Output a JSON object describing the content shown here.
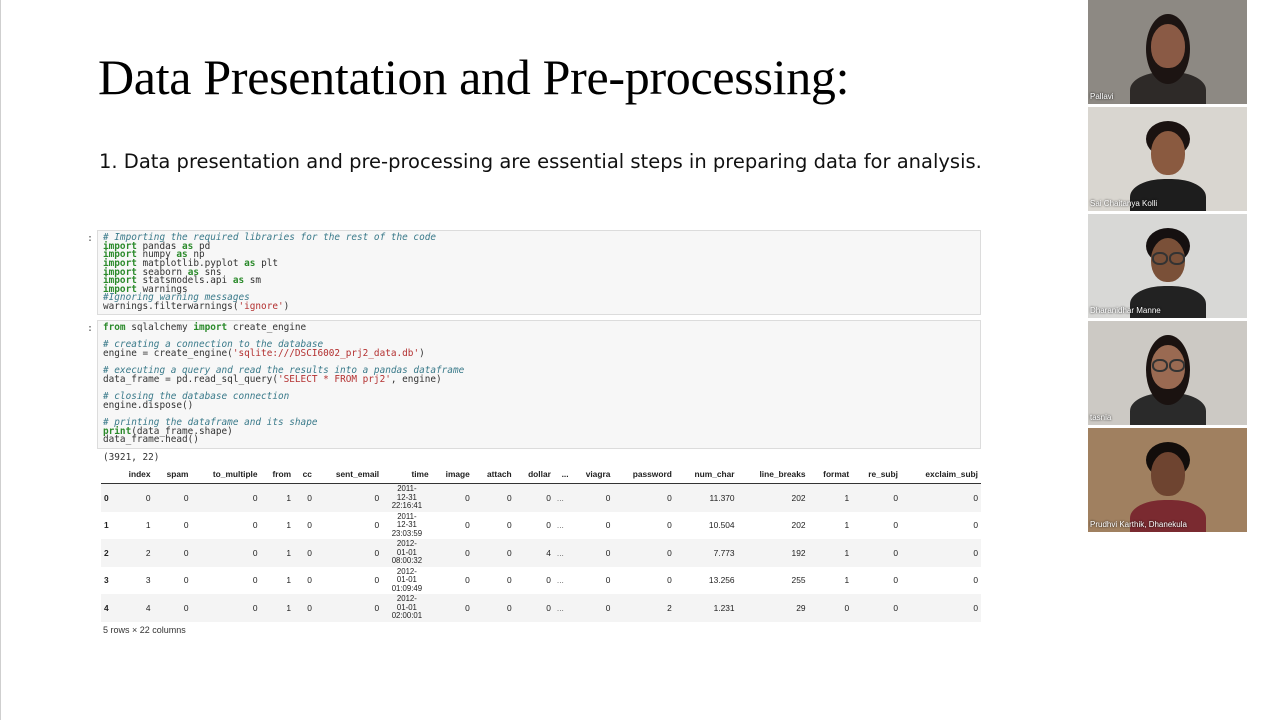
{
  "slide": {
    "title": "Data Presentation and Pre-processing:",
    "bullet": "1. Data presentation and pre-processing are essential steps in preparing data for analysis."
  },
  "notebook": {
    "cell1": {
      "prompt": ":",
      "lines": [
        [
          {
            "t": "# Importing the required libraries for the rest of the code",
            "c": "cmt"
          }
        ],
        [
          {
            "t": "import",
            "c": "kw"
          },
          {
            "t": " pandas "
          },
          {
            "t": "as",
            "c": "kw"
          },
          {
            "t": " pd"
          }
        ],
        [
          {
            "t": "import",
            "c": "kw"
          },
          {
            "t": " numpy "
          },
          {
            "t": "as",
            "c": "kw"
          },
          {
            "t": " np"
          }
        ],
        [
          {
            "t": "import",
            "c": "kw"
          },
          {
            "t": " matplotlib.pyplot "
          },
          {
            "t": "as",
            "c": "kw"
          },
          {
            "t": " plt"
          }
        ],
        [
          {
            "t": "import",
            "c": "kw"
          },
          {
            "t": " seaborn "
          },
          {
            "t": "as",
            "c": "kw"
          },
          {
            "t": " sns"
          }
        ],
        [
          {
            "t": "import",
            "c": "kw"
          },
          {
            "t": " statsmodels.api "
          },
          {
            "t": "as",
            "c": "kw"
          },
          {
            "t": " sm"
          }
        ],
        [
          {
            "t": "import",
            "c": "kw"
          },
          {
            "t": " warnings"
          }
        ],
        [
          {
            "t": "#Ignoring warning messages",
            "c": "cmt"
          }
        ],
        [
          {
            "t": "warnings.filterwarnings("
          },
          {
            "t": "'ignore'",
            "c": "str"
          },
          {
            "t": ")"
          }
        ]
      ]
    },
    "cell2": {
      "prompt": ":",
      "lines": [
        [
          {
            "t": "from",
            "c": "kw"
          },
          {
            "t": " sqlalchemy "
          },
          {
            "t": "import",
            "c": "kw"
          },
          {
            "t": " create_engine"
          }
        ],
        [],
        [
          {
            "t": "# creating a connection to the database",
            "c": "cmt"
          }
        ],
        [
          {
            "t": "engine = create_engine("
          },
          {
            "t": "'sqlite:///DSCI6002_prj2_data.db'",
            "c": "str"
          },
          {
            "t": ")"
          }
        ],
        [],
        [
          {
            "t": "# executing a query and read the results into a pandas dataframe",
            "c": "cmt"
          }
        ],
        [
          {
            "t": "data_frame = pd.read_sql_query("
          },
          {
            "t": "'SELECT * FROM prj2'",
            "c": "str"
          },
          {
            "t": ", engine)"
          }
        ],
        [],
        [
          {
            "t": "# closing the database connection",
            "c": "cmt"
          }
        ],
        [
          {
            "t": "engine.dispose()"
          }
        ],
        [],
        [
          {
            "t": "# printing the dataframe and its shape",
            "c": "cmt"
          }
        ],
        [
          {
            "t": "print",
            "c": "kw"
          },
          {
            "t": "(data_frame.shape)"
          }
        ],
        [
          {
            "t": "data_frame.head()"
          }
        ]
      ]
    },
    "shape_output": "(3921, 22)",
    "dataframe": {
      "columns": [
        "",
        "index",
        "spam",
        "to_multiple",
        "from",
        "cc",
        "sent_email",
        "time",
        "image",
        "attach",
        "dollar",
        "...",
        "viagra",
        "password",
        "num_char",
        "line_breaks",
        "format",
        "re_subj",
        "exclaim_subj"
      ],
      "rows": [
        [
          "0",
          "0",
          "0",
          "0",
          "1",
          "0",
          "0",
          [
            "2011-",
            "12-31",
            "22:16:41"
          ],
          "0",
          "0",
          "0",
          "...",
          "0",
          "0",
          "11.370",
          "202",
          "1",
          "0",
          "0"
        ],
        [
          "1",
          "1",
          "0",
          "0",
          "1",
          "0",
          "0",
          [
            "2011-",
            "12-31",
            "23:03:59"
          ],
          "0",
          "0",
          "0",
          "...",
          "0",
          "0",
          "10.504",
          "202",
          "1",
          "0",
          "0"
        ],
        [
          "2",
          "2",
          "0",
          "0",
          "1",
          "0",
          "0",
          [
            "2012-",
            "01-01",
            "08:00:32"
          ],
          "0",
          "0",
          "4",
          "...",
          "0",
          "0",
          "7.773",
          "192",
          "1",
          "0",
          "0"
        ],
        [
          "3",
          "3",
          "0",
          "0",
          "1",
          "0",
          "0",
          [
            "2012-",
            "01-01",
            "01:09:49"
          ],
          "0",
          "0",
          "0",
          "...",
          "0",
          "0",
          "13.256",
          "255",
          "1",
          "0",
          "0"
        ],
        [
          "4",
          "4",
          "0",
          "0",
          "1",
          "0",
          "0",
          [
            "2012-",
            "01-01",
            "02:00:01"
          ],
          "0",
          "0",
          "0",
          "...",
          "0",
          "2",
          "1.231",
          "29",
          "0",
          "0",
          "0"
        ]
      ],
      "footer": "5 rows × 22 columns"
    }
  },
  "participants": [
    {
      "name": "Pallavi",
      "bg": "#8d8983",
      "skin": "#8a5a45",
      "hair": "#1c1412",
      "shirt": "#2e2a28"
    },
    {
      "name": "Sai Chaitanya Kolli",
      "bg": "#d9d6d0",
      "skin": "#8a5a40",
      "hair": "#1a1210",
      "shirt": "#1d1d1d"
    },
    {
      "name": "Dharanidhar Manne",
      "bg": "#d8d8d6",
      "skin": "#7a5038",
      "hair": "#151010",
      "shirt": "#222222"
    },
    {
      "name": "tasnia",
      "bg": "#ccc9c4",
      "skin": "#9a6a52",
      "hair": "#1a1210",
      "shirt": "#2a2a2a"
    },
    {
      "name": "Prudhvi Karthik, Dhanekula",
      "bg": "#a08060",
      "skin": "#6e4430",
      "hair": "#120d0b",
      "shirt": "#7a2a30"
    }
  ]
}
